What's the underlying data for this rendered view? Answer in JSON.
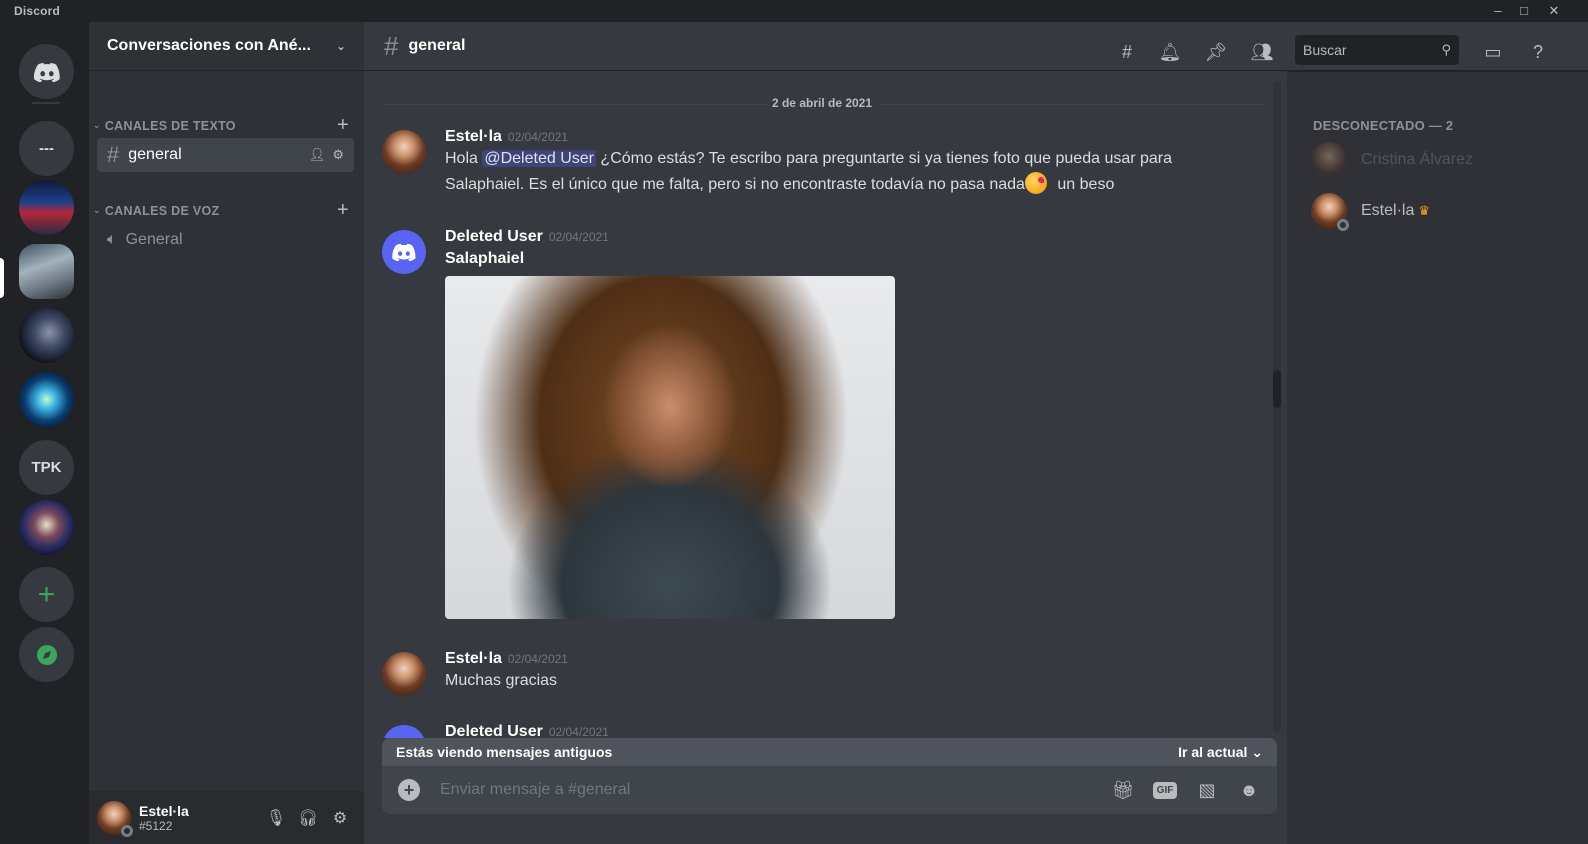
{
  "app": {
    "brand": "Discord",
    "window_controls": [
      "–",
      "□",
      "✕"
    ]
  },
  "servers": {
    "dash_label": "---",
    "tpk_label": "TPK",
    "add_label": "+"
  },
  "guild": {
    "name": "Conversaciones con Ané...",
    "text_category": "CANALES DE TEXTO",
    "voice_category": "CANALES DE VOZ",
    "text_channel": "general",
    "voice_channel": "General"
  },
  "user_panel": {
    "name": "Estel·la",
    "tag": "#5122"
  },
  "channel_header": {
    "title": "general",
    "search_placeholder": "Buscar"
  },
  "chat": {
    "date_divider": "2 de abril de 2021",
    "messages": [
      {
        "author": "Estel·la",
        "time": "02/04/2021",
        "pre": "Hola ",
        "mention": "@Deleted User",
        "post": " ¿Cómo estás? Te escribo para preguntarte si ya tienes foto que pueda usar para Salaphaiel. Es el único que me falta, pero si no encontraste todavía no pasa nada",
        "tail": " un beso"
      },
      {
        "author": "Deleted User",
        "time": "02/04/2021",
        "text": "Salaphaiel"
      },
      {
        "author": "Estel·la",
        "time": "02/04/2021",
        "text": "Muchas gracias"
      },
      {
        "author": "Deleted User",
        "time": "02/04/2021"
      }
    ],
    "old_messages_notice": "Estás viendo mensajes antiguos",
    "jump_to_present": "Ir al actual",
    "composer_placeholder": "Enviar mensaje a #general",
    "gif_label": "GIF"
  },
  "members": {
    "category": "DESCONECTADO — 2",
    "list": [
      {
        "name": "Cristina Álvarez",
        "color": "#5c5f66"
      },
      {
        "name": "Estel·la",
        "color": "#b9bbbe",
        "owner": true
      }
    ]
  },
  "colors": {
    "accent": "#5865f2",
    "green": "#3ba55d",
    "crown": "#faa61a"
  }
}
